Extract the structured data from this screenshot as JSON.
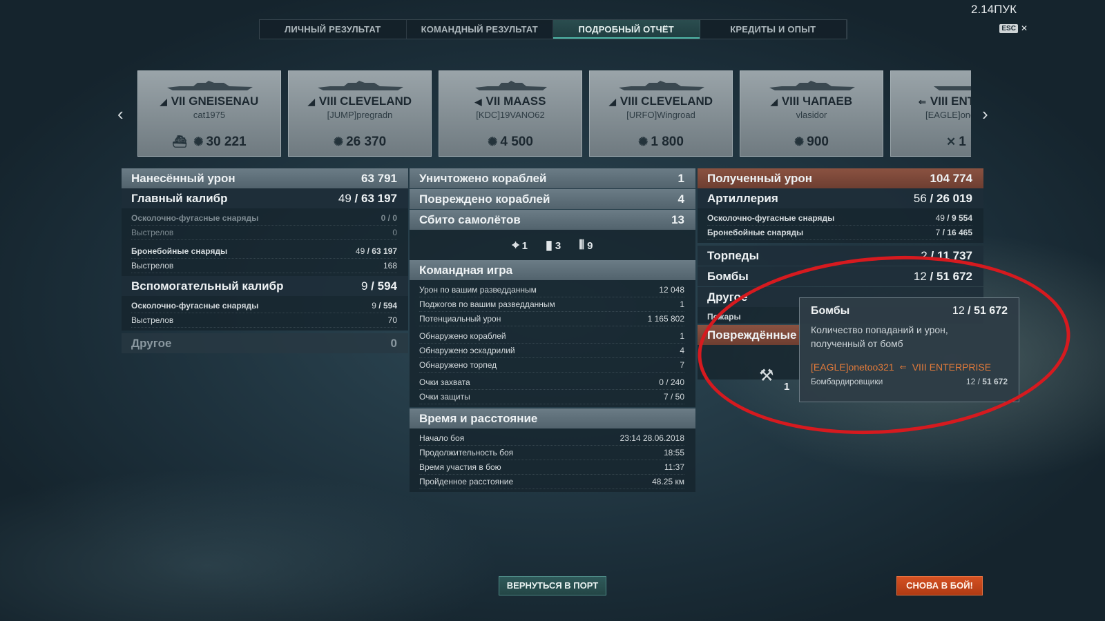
{
  "top_right_text": "2.14ПУК",
  "esc_label": "ESC",
  "tabs": [
    {
      "label": "ЛИЧНЫЙ РЕЗУЛЬТАТ"
    },
    {
      "label": "КОМАНДНЫЙ РЕЗУЛЬТАТ"
    },
    {
      "label": "ПОДРОБНЫЙ ОТЧЁТ"
    },
    {
      "label": "КРЕДИТЫ И ОПЫТ"
    }
  ],
  "ships": [
    {
      "tier": "VII",
      "name": "GNEISENAU",
      "player": "cat1975",
      "score": "30 221"
    },
    {
      "tier": "VIII",
      "name": "CLEVELAND",
      "player": "[JUMP]pregradn",
      "score": "26 370"
    },
    {
      "tier": "VII",
      "name": "MAASS",
      "player": "[KDC]19VANO62",
      "score": "4 500"
    },
    {
      "tier": "VIII",
      "name": "CLEVELAND",
      "player": "[URFO]Wingroad",
      "score": "1 800"
    },
    {
      "tier": "VIII",
      "name": "ЧАПАЕВ",
      "player": "vlasidor",
      "score": "900"
    },
    {
      "tier": "VIII",
      "name": "ENTE",
      "player": "[EAGLE]one",
      "score": "1"
    }
  ],
  "damage_dealt": {
    "title": "Нанесённый урон",
    "total": "63 791",
    "main": {
      "title": "Главный калибр",
      "hits": "49",
      "damage": "63 197"
    },
    "main_he": {
      "label": "Осколочно-фугасные снаряды",
      "hits": "0",
      "damage": "0"
    },
    "main_he_shots": {
      "label": "Выстрелов",
      "value": "0"
    },
    "main_ap": {
      "label": "Бронебойные снаряды",
      "hits": "49",
      "damage": "63 197"
    },
    "main_ap_shots": {
      "label": "Выстрелов",
      "value": "168"
    },
    "secondary": {
      "title": "Вспомогательный калибр",
      "hits": "9",
      "damage": "594"
    },
    "sec_he": {
      "label": "Осколочно-фугасные снаряды",
      "hits": "9",
      "damage": "594"
    },
    "sec_shots": {
      "label": "Выстрелов",
      "value": "70"
    },
    "other": {
      "title": "Другое",
      "value": "0"
    }
  },
  "middle": {
    "destroyed": {
      "label": "Уничтожено кораблей",
      "value": "1"
    },
    "damaged": {
      "label": "Повреждено кораблей",
      "value": "4"
    },
    "planes": {
      "label": "Сбито самолётов",
      "value": "13"
    },
    "aircraft": [
      {
        "icon": "fighter",
        "count": "1"
      },
      {
        "icon": "bomber",
        "count": "3"
      },
      {
        "icon": "torpedo-bomber",
        "count": "9"
      }
    ],
    "team": {
      "title": "Командная игра",
      "rows": [
        {
          "label": "Урон по вашим разведданным",
          "value": "12 048"
        },
        {
          "label": "Поджогов по вашим разведданным",
          "value": "1"
        },
        {
          "label": "Потенциальный урон",
          "value": "1 165 802"
        },
        {
          "label": "Обнаружено кораблей",
          "value": "1"
        },
        {
          "label": "Обнаружено эскадрилий",
          "value": "4"
        },
        {
          "label": "Обнаружено торпед",
          "value": "7"
        },
        {
          "label": "Очки захвата",
          "value": "0 / 240"
        },
        {
          "label": "Очки защиты",
          "value": "7 / 50"
        }
      ]
    },
    "time": {
      "title": "Время и расстояние",
      "rows": [
        {
          "label": "Начало боя",
          "value": "23:14  28.06.2018"
        },
        {
          "label": "Продолжительность боя",
          "value": "18:55"
        },
        {
          "label": "Время участия в бою",
          "value": "11:37"
        },
        {
          "label": "Пройденное расстояние",
          "value": "48.25 км"
        }
      ]
    }
  },
  "damage_received": {
    "title": "Полученный урон",
    "total": "104 774",
    "artillery": {
      "title": "Артиллерия",
      "hits": "56",
      "damage": "26 019"
    },
    "he": {
      "label": "Осколочно-фугасные снаряды",
      "hits": "49",
      "damage": "9 554"
    },
    "ap": {
      "label": "Бронебойные снаряды",
      "hits": "7",
      "damage": "16 465"
    },
    "torpedoes": {
      "title": "Торпеды",
      "hits": "2",
      "damage": "11 737"
    },
    "bombs": {
      "title": "Бомбы",
      "hits": "12",
      "damage": "51 672"
    },
    "other": {
      "title": "Другое"
    },
    "fires": {
      "label": "Пожары"
    },
    "damaged_title": "Повреждённые",
    "medal_count": "1"
  },
  "tooltip": {
    "title": "Бомбы",
    "hits": "12",
    "damage": "51 672",
    "description_1": "Количество попаданий и урон,",
    "description_2": "полученный от бомб",
    "source_player": "[EAGLE]onetoo321",
    "source_ship": "VIII ENTERPRISE",
    "row_label": "Бомбардировщики",
    "row_hits": "12",
    "row_damage": "51 672"
  },
  "buttons": {
    "port": "ВЕРНУТЬСЯ В ПОРТ",
    "again": "СНОВА В БОЙ!"
  },
  "colors": {
    "accent": "#4fb8a8",
    "danger": "#d61a1f",
    "orange": "#e27a3a"
  }
}
